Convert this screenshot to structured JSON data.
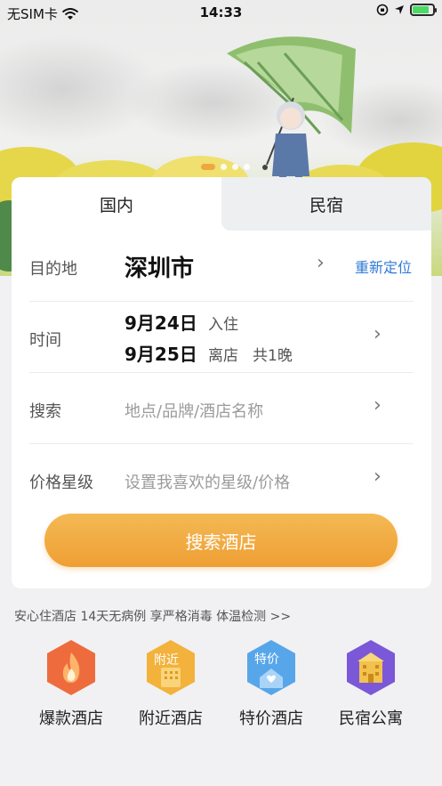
{
  "status_bar": {
    "carrier": "无SIM卡",
    "time": "14:33"
  },
  "hero": {
    "active_slide_index": 0,
    "slide_count": 4
  },
  "tabs": [
    {
      "label": "国内",
      "selected": true
    },
    {
      "label": "民宿",
      "selected": false
    }
  ],
  "destination": {
    "label": "目的地",
    "city": "深圳市",
    "relocate": "重新定位"
  },
  "time": {
    "label": "时间",
    "checkin_date": "9月24日",
    "checkin_tag": "入住",
    "checkout_date": "9月25日",
    "checkout_tag": "离店",
    "nights": "共1晚"
  },
  "search": {
    "label": "搜索",
    "placeholder": "地点/品牌/酒店名称"
  },
  "price": {
    "label": "价格星级",
    "placeholder": "设置我喜欢的星级/价格"
  },
  "search_button": "搜索酒店",
  "notice": "安心住酒店 14天无病例 享严格消毒 体温检测 >>",
  "quick_links": [
    {
      "label": "爆款酒店",
      "icon": "fire-icon",
      "color": "#ee6b3d"
    },
    {
      "label": "附近酒店",
      "icon": "nearby-icon",
      "color": "#f2b23b",
      "badge": "附近"
    },
    {
      "label": "特价酒店",
      "icon": "discount-house-icon",
      "color": "#58a6ea",
      "badge": "特价"
    },
    {
      "label": "民宿公寓",
      "icon": "homestay-icon",
      "color": "#7b58d8"
    }
  ]
}
